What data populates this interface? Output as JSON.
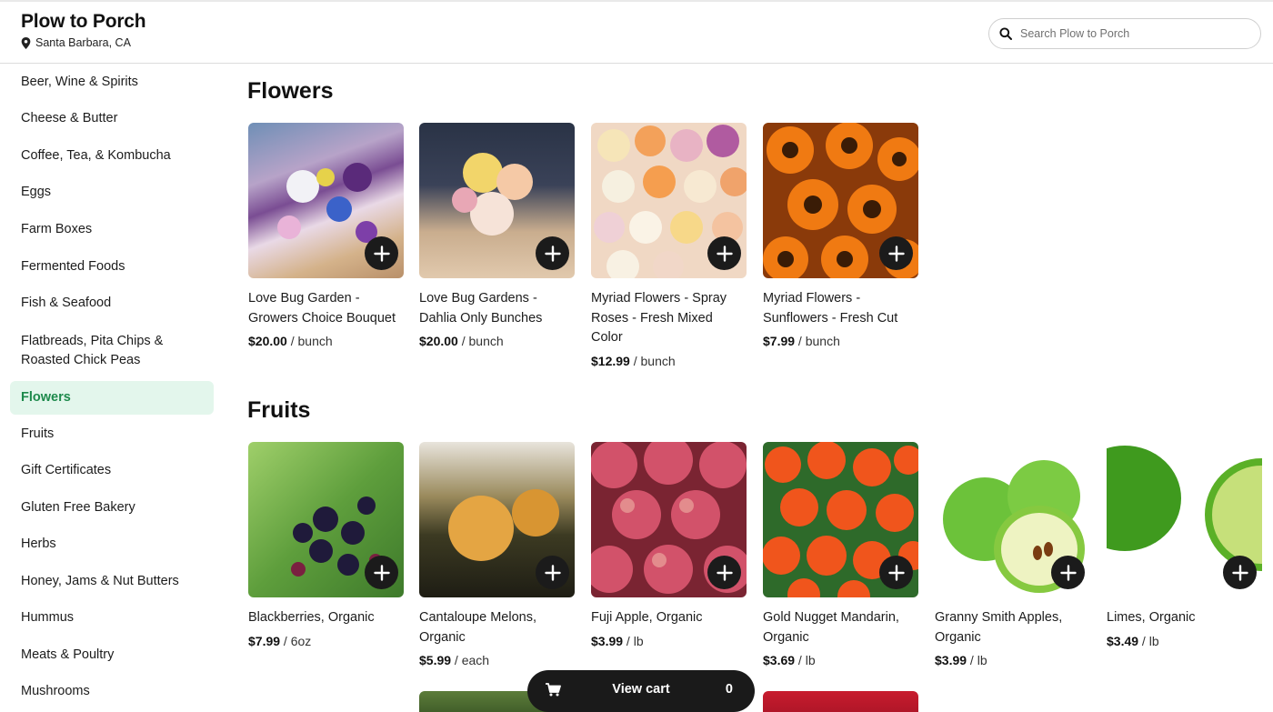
{
  "header": {
    "store_name": "Plow to Porch",
    "location": "Santa Barbara, CA",
    "search_placeholder": "Search Plow to Porch"
  },
  "sidebar": {
    "items": [
      {
        "label": "Beer, Wine & Spirits"
      },
      {
        "label": "Cheese & Butter"
      },
      {
        "label": "Coffee, Tea, & Kombucha"
      },
      {
        "label": "Eggs"
      },
      {
        "label": "Farm Boxes"
      },
      {
        "label": "Fermented Foods"
      },
      {
        "label": "Fish & Seafood"
      },
      {
        "label": "Flatbreads, Pita Chips & Roasted Chick Peas"
      },
      {
        "label": "Flowers",
        "active": true
      },
      {
        "label": "Fruits"
      },
      {
        "label": "Gift Certificates"
      },
      {
        "label": "Gluten Free Bakery"
      },
      {
        "label": "Herbs"
      },
      {
        "label": "Honey, Jams & Nut Butters"
      },
      {
        "label": "Hummus"
      },
      {
        "label": "Meats & Poultry"
      },
      {
        "label": "Mushrooms"
      }
    ]
  },
  "sections": [
    {
      "title": "Flowers",
      "products": [
        {
          "name": "Love Bug Garden - Growers Choice Bouquet",
          "price": "$20.00",
          "unit": " / bunch"
        },
        {
          "name": "Love Bug Gardens - Dahlia Only Bunches",
          "price": "$20.00",
          "unit": " / bunch"
        },
        {
          "name": "Myriad Flowers - Spray Roses - Fresh Mixed Color",
          "price": "$12.99",
          "unit": " / bunch"
        },
        {
          "name": "Myriad Flowers - Sunflowers - Fresh Cut",
          "price": "$7.99",
          "unit": " / bunch"
        }
      ]
    },
    {
      "title": "Fruits",
      "products": [
        {
          "name": "Blackberries, Organic",
          "price": "$7.99",
          "unit": " / 6oz"
        },
        {
          "name": "Cantaloupe Melons, Organic",
          "price": "$5.99",
          "unit": " / each"
        },
        {
          "name": "Fuji Apple, Organic",
          "price": "$3.99",
          "unit": " / lb"
        },
        {
          "name": "Gold Nugget Mandarin, Organic",
          "price": "$3.69",
          "unit": " / lb"
        },
        {
          "name": "Granny Smith Apples, Organic",
          "price": "$3.99",
          "unit": " / lb"
        },
        {
          "name": "Limes, Organic",
          "price": "$3.49",
          "unit": " / lb"
        }
      ]
    }
  ],
  "cart": {
    "label": "View cart",
    "count": "0"
  },
  "icons": {
    "search": "search-icon",
    "pin": "location-pin-icon",
    "add": "plus-icon",
    "cart": "shopping-cart-icon"
  },
  "colors": {
    "active_bg": "#e3f6ec",
    "active_text": "#1e8a4c",
    "button_dark": "#1b1b1b"
  }
}
